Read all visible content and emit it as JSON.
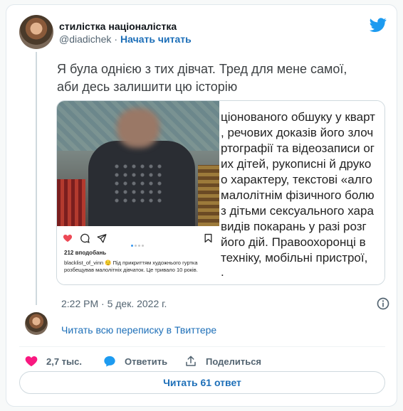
{
  "author": {
    "display_name": "стилістка націоналістка",
    "handle": "@diadichek",
    "separator": "·",
    "follow_label": "Начать читать"
  },
  "tweet": {
    "text_line1": "Я була однією з тих дівчат. Тред  для мене самої,",
    "text_line2": "аби десь залишити цю історію"
  },
  "media": {
    "instagram": {
      "likes": "212 вподобань",
      "caption": "blacklist_of_vinn 😌 Під прикриттям художнього гуртка розбещував малолітніх дівчаток. Це тривало 10 років."
    },
    "document_lines": [
      "ціонованого обшуку у кварт",
      ", речових доказів його злоч",
      "ртографії та відеозаписи ог",
      "их дітей, рукописні й друко",
      "о характеру, текстові «алго",
      "малолітнім фізичного болю",
      "з дітьми сексуального хара",
      "видів покарань у разі розг",
      "його дій. Правоохоронці в",
      "техніку, мобільні пристрої,",
      "."
    ]
  },
  "meta": {
    "timestamp": "2:22 PM · 5 дек. 2022 г."
  },
  "thread": {
    "read_all_label": "Читать всю переписку в Твиттере"
  },
  "actions": {
    "likes_count": "2,7 тыс.",
    "reply_label": "Ответить",
    "share_label": "Поделиться"
  },
  "replies_button": "Читать 61 ответ",
  "colors": {
    "twitter_blue": "#1d9bf0",
    "link_blue": "#1d6fb8",
    "like_pink": "#f91880"
  }
}
